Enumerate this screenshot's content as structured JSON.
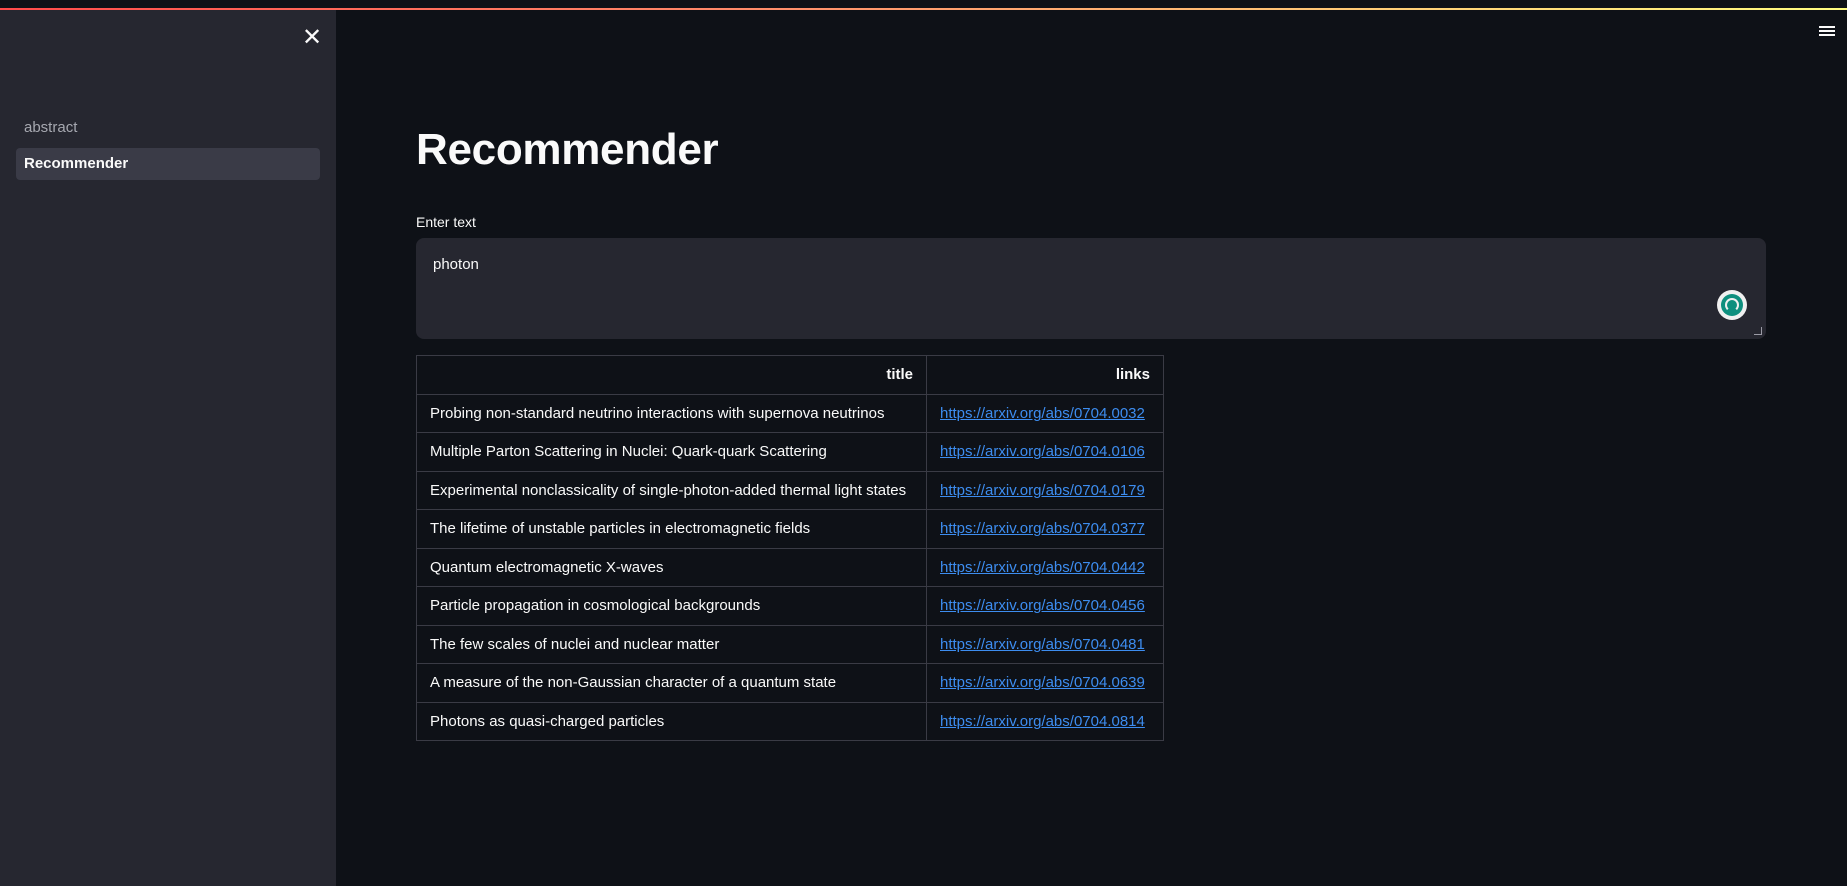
{
  "sidebar": {
    "close_icon": "✕",
    "items": [
      {
        "label": "abstract",
        "active": false
      },
      {
        "label": "Recommender",
        "active": true
      }
    ]
  },
  "header": {
    "menu_icon": "hamburger-icon"
  },
  "main": {
    "title": "Recommender",
    "input": {
      "label": "Enter text",
      "value": "photon"
    },
    "table": {
      "columns": [
        "title",
        "links"
      ],
      "rows": [
        {
          "title": "Probing non-standard neutrino interactions with supernova neutrinos",
          "link": "https://arxiv.org/abs/0704.0032"
        },
        {
          "title": "Multiple Parton Scattering in Nuclei: Quark-quark Scattering",
          "link": "https://arxiv.org/abs/0704.0106"
        },
        {
          "title": "Experimental nonclassicality of single-photon-added thermal light states",
          "link": "https://arxiv.org/abs/0704.0179"
        },
        {
          "title": "The lifetime of unstable particles in electromagnetic fields",
          "link": "https://arxiv.org/abs/0704.0377"
        },
        {
          "title": "Quantum electromagnetic X-waves",
          "link": "https://arxiv.org/abs/0704.0442"
        },
        {
          "title": "Particle propagation in cosmological backgrounds",
          "link": "https://arxiv.org/abs/0704.0456"
        },
        {
          "title": "The few scales of nuclei and nuclear matter",
          "link": "https://arxiv.org/abs/0704.0481"
        },
        {
          "title": "A measure of the non-Gaussian character of a quantum state",
          "link": "https://arxiv.org/abs/0704.0639"
        },
        {
          "title": "Photons as quasi-charged particles",
          "link": "https://arxiv.org/abs/0704.0814"
        }
      ]
    }
  },
  "colors": {
    "background": "#0e1117",
    "sidebar": "#262730",
    "link": "#3d8df0",
    "spinner": "#0e8f7e"
  }
}
